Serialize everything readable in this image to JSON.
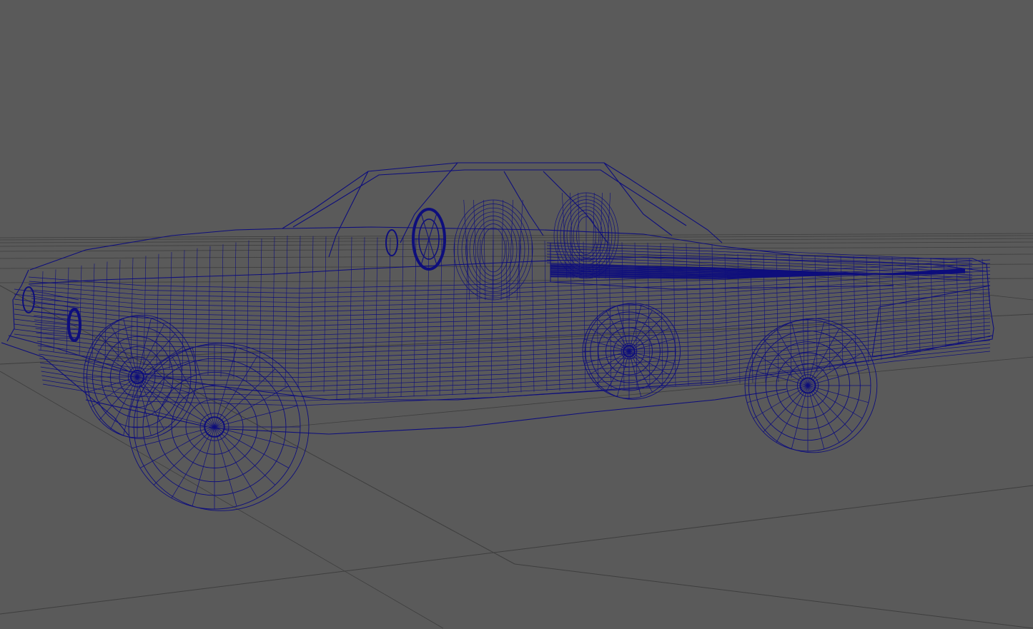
{
  "viewport": {
    "display_mode": "wireframe",
    "background_color": "#5a5a5a",
    "grid_color": "#3e3e3e",
    "wire_color": "#0e0e7c"
  },
  "scene": {
    "object": "car-wireframe-model",
    "show_grid": true
  }
}
